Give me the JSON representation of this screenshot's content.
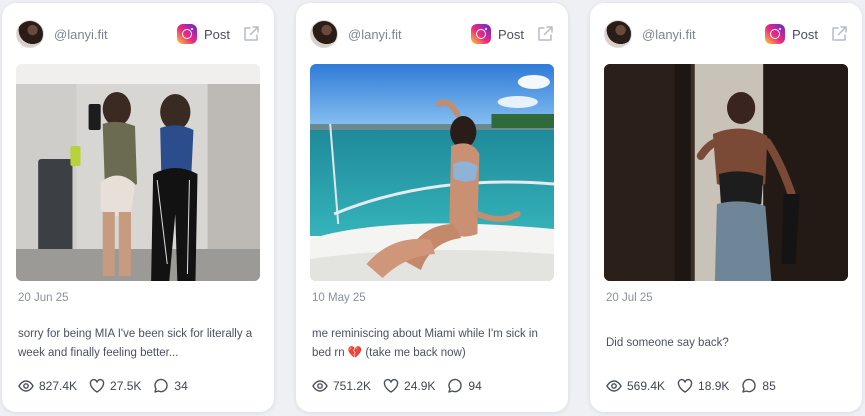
{
  "posts": [
    {
      "handle": "@lanyi.fit",
      "platform_label": "Post",
      "date": "20 Jun 25",
      "caption": "sorry for being MIA I've been sick for literally a week and finally feeling better...",
      "views": "827.4K",
      "likes": "27.5K",
      "comments": "34"
    },
    {
      "handle": "@lanyi.fit",
      "platform_label": "Post",
      "date": "10 May 25",
      "caption": "me reminiscing about Miami while I'm sick in bed rn 💔 (take me back now)",
      "views": "751.2K",
      "likes": "24.9K",
      "comments": "94"
    },
    {
      "handle": "@lanyi.fit",
      "platform_label": "Post",
      "date": "20 Jul 25",
      "caption": "Did someone say back?",
      "views": "569.4K",
      "likes": "18.9K",
      "comments": "85"
    }
  ],
  "icons": {
    "platform": "instagram-icon",
    "external": "external-link-icon",
    "views": "eye-icon",
    "likes": "heart-icon",
    "comments": "comment-icon"
  },
  "colors": {
    "background": "#eef0f4",
    "card": "#ffffff",
    "muted_text": "#8a909c"
  }
}
